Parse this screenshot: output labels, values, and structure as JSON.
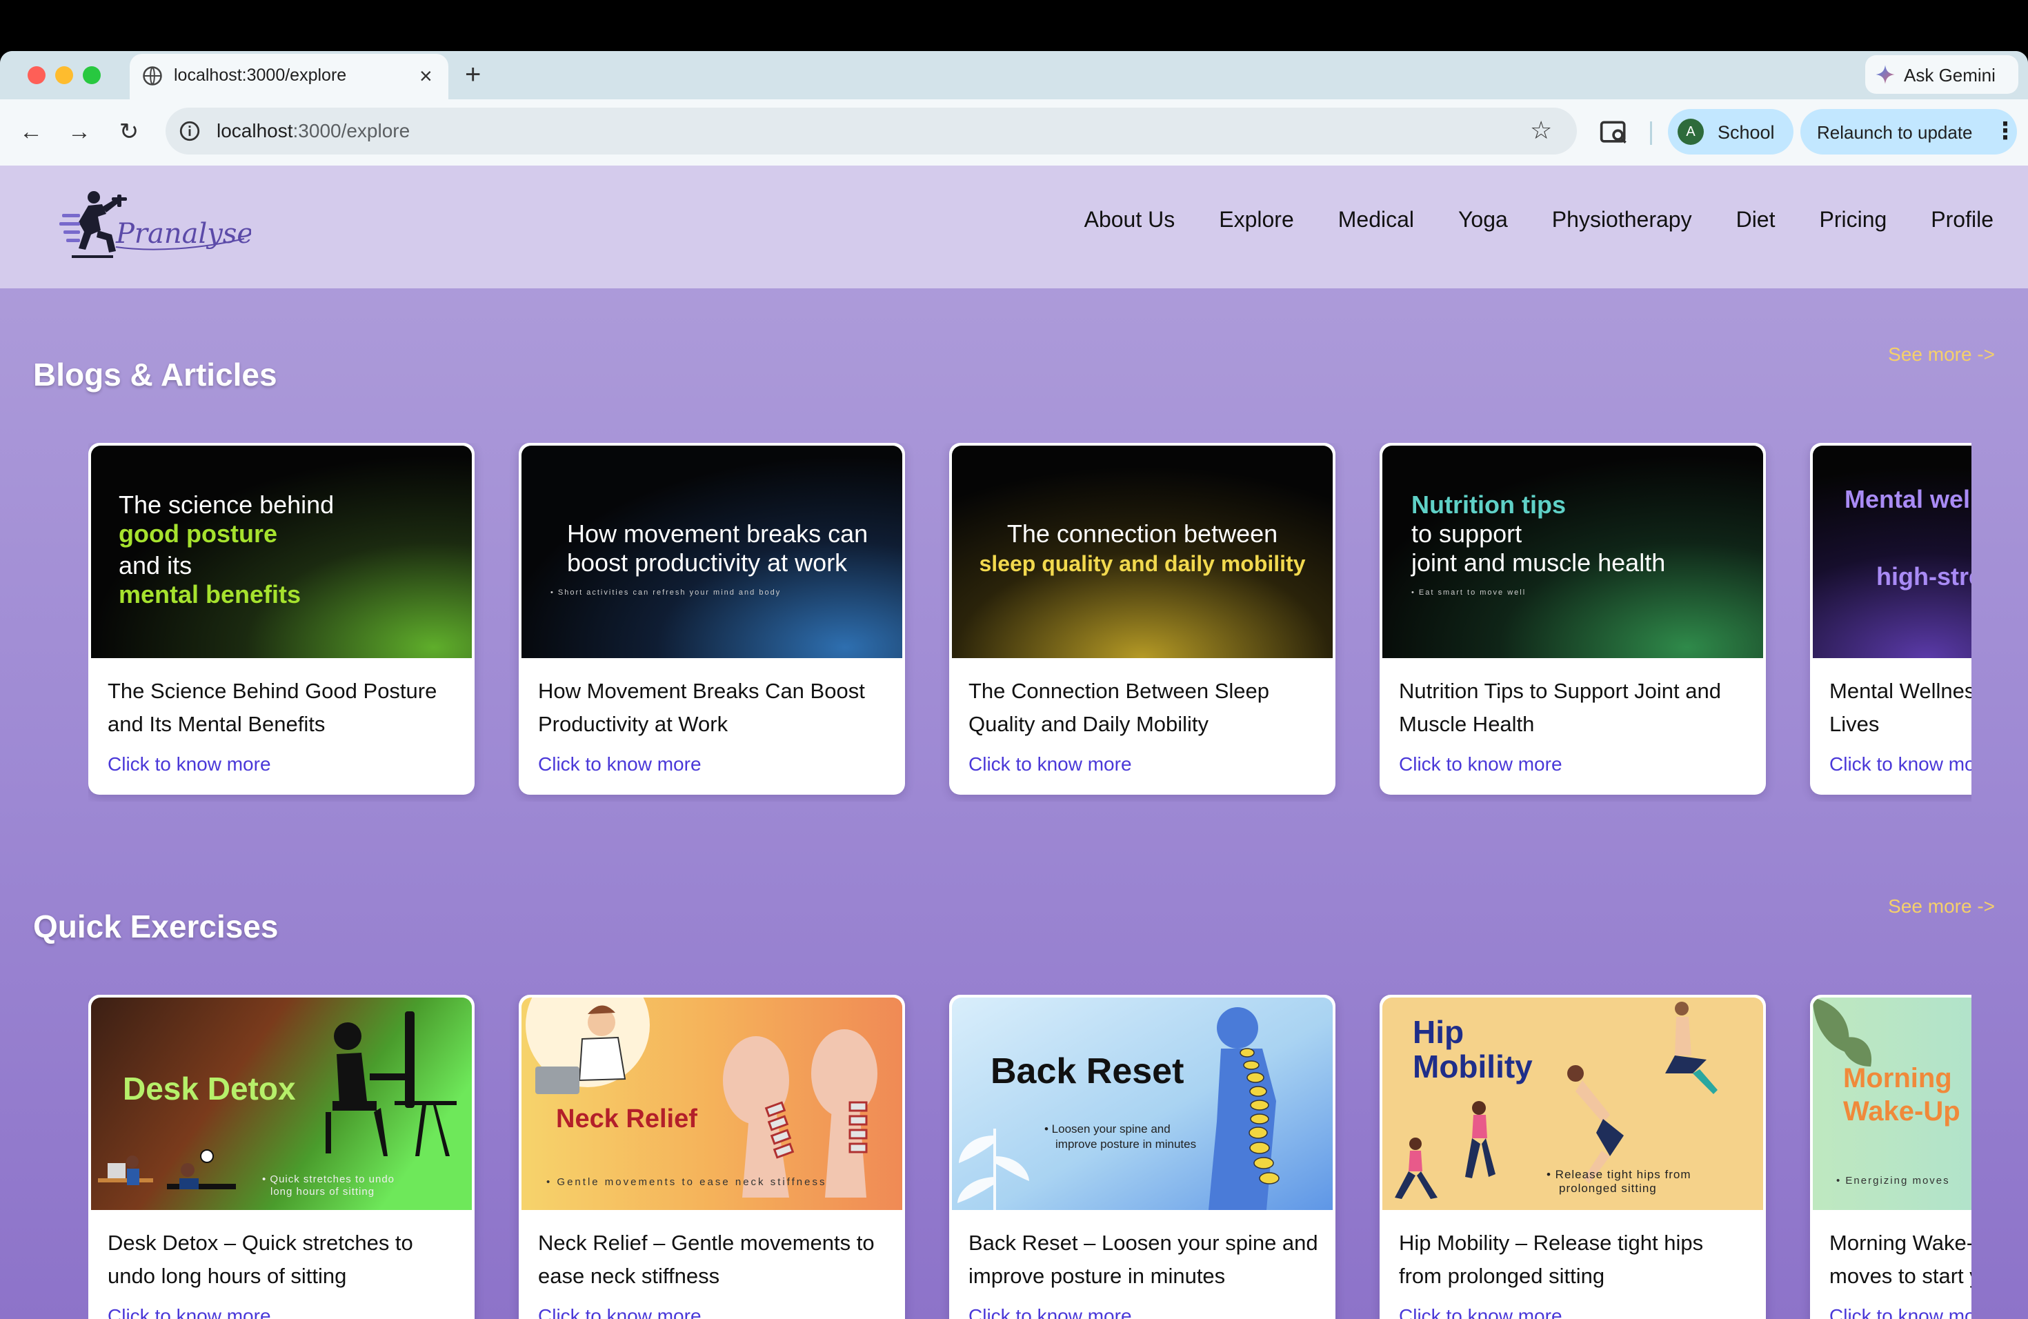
{
  "browser": {
    "tab_title": "localhost:3000/explore",
    "url_host": "localhost",
    "url_path": ":3000/explore",
    "ask_gemini": "Ask Gemini",
    "profile_initial": "A",
    "profile_label": "School",
    "relaunch_label": "Relaunch to update",
    "new_tab_glyph": "+",
    "close_glyph": "×"
  },
  "site": {
    "logo_text": "Pranalyse",
    "nav": [
      "About Us",
      "Explore",
      "Medical",
      "Yoga",
      "Physiotherapy",
      "Diet",
      "Pricing",
      "Profile"
    ]
  },
  "blogs": {
    "title": "Blogs & Articles",
    "see_more": "See more ->",
    "cards": [
      {
        "title": "The Science Behind Good Posture and Its Mental Benefits",
        "link": "Click to know more",
        "image": {
          "l1": "The science behind",
          "l2": "good posture",
          "l3": "and its",
          "l4": "mental benefits",
          "accent": "#a6e22e"
        }
      },
      {
        "title": "How Movement Breaks Can Boost Productivity at Work",
        "link": "Click to know more",
        "image": {
          "l1": "How movement breaks can",
          "l2": "boost productivity at work",
          "sub": "• Short activities can refresh your mind and body"
        }
      },
      {
        "title": "The Connection Between Sleep Quality and Daily Mobility",
        "link": "Click to know more",
        "image": {
          "l1": "The connection between",
          "l2": "sleep quality and daily mobility",
          "accent": "#f2d94e"
        }
      },
      {
        "title": "Nutrition Tips to Support Joint and Muscle Health",
        "link": "Click to know more",
        "image": {
          "l1": "Nutrition tips",
          "l2": "to support",
          "l3": "joint and muscle health",
          "sub": "• Eat smart to move well",
          "accent": "#5fd1c7"
        }
      },
      {
        "title": "Mental Wellness in High-Stress Lives",
        "link": "Click to know more",
        "image": {
          "l1": "Mental wellness",
          "l2": "high-stress",
          "accent": "#a98bf5"
        }
      }
    ]
  },
  "exercises": {
    "title": "Quick Exercises",
    "see_more": "See more ->",
    "cards": [
      {
        "title": "Desk Detox – Quick stretches to undo long hours of sitting",
        "link": "Click to know more",
        "image": {
          "l1": "Desk Detox",
          "sub1": "• Quick stretches to undo",
          "sub2": "long hours of sitting"
        }
      },
      {
        "title": "Neck Relief – Gentle movements to ease neck stiffness",
        "link": "Click to know more",
        "image": {
          "l1": "Neck Relief",
          "sub1": "• Gentle movements to ease neck stiffness"
        }
      },
      {
        "title": "Back Reset – Loosen your spine and improve posture in minutes",
        "link": "Click to know more",
        "image": {
          "l1": "Back Reset",
          "sub1": "• Loosen your spine and",
          "sub2": "improve posture in minutes"
        }
      },
      {
        "title": "Hip Mobility – Release tight hips from prolonged sitting",
        "link": "Click to know more",
        "image": {
          "l1": "Hip",
          "l2": "Mobility",
          "sub1": "• Release tight hips from",
          "sub2": "prolonged sitting"
        }
      },
      {
        "title": "Morning Wake-Up – Energizing moves to start your day",
        "link": "Click to know more",
        "image": {
          "l1": "Morning",
          "l2": "Wake-Up",
          "sub1": "• Energizing moves"
        }
      }
    ]
  },
  "colors": {
    "link": "#4a38d8",
    "see_more": "#f5d06a",
    "header_bg": "#d4cbec"
  }
}
